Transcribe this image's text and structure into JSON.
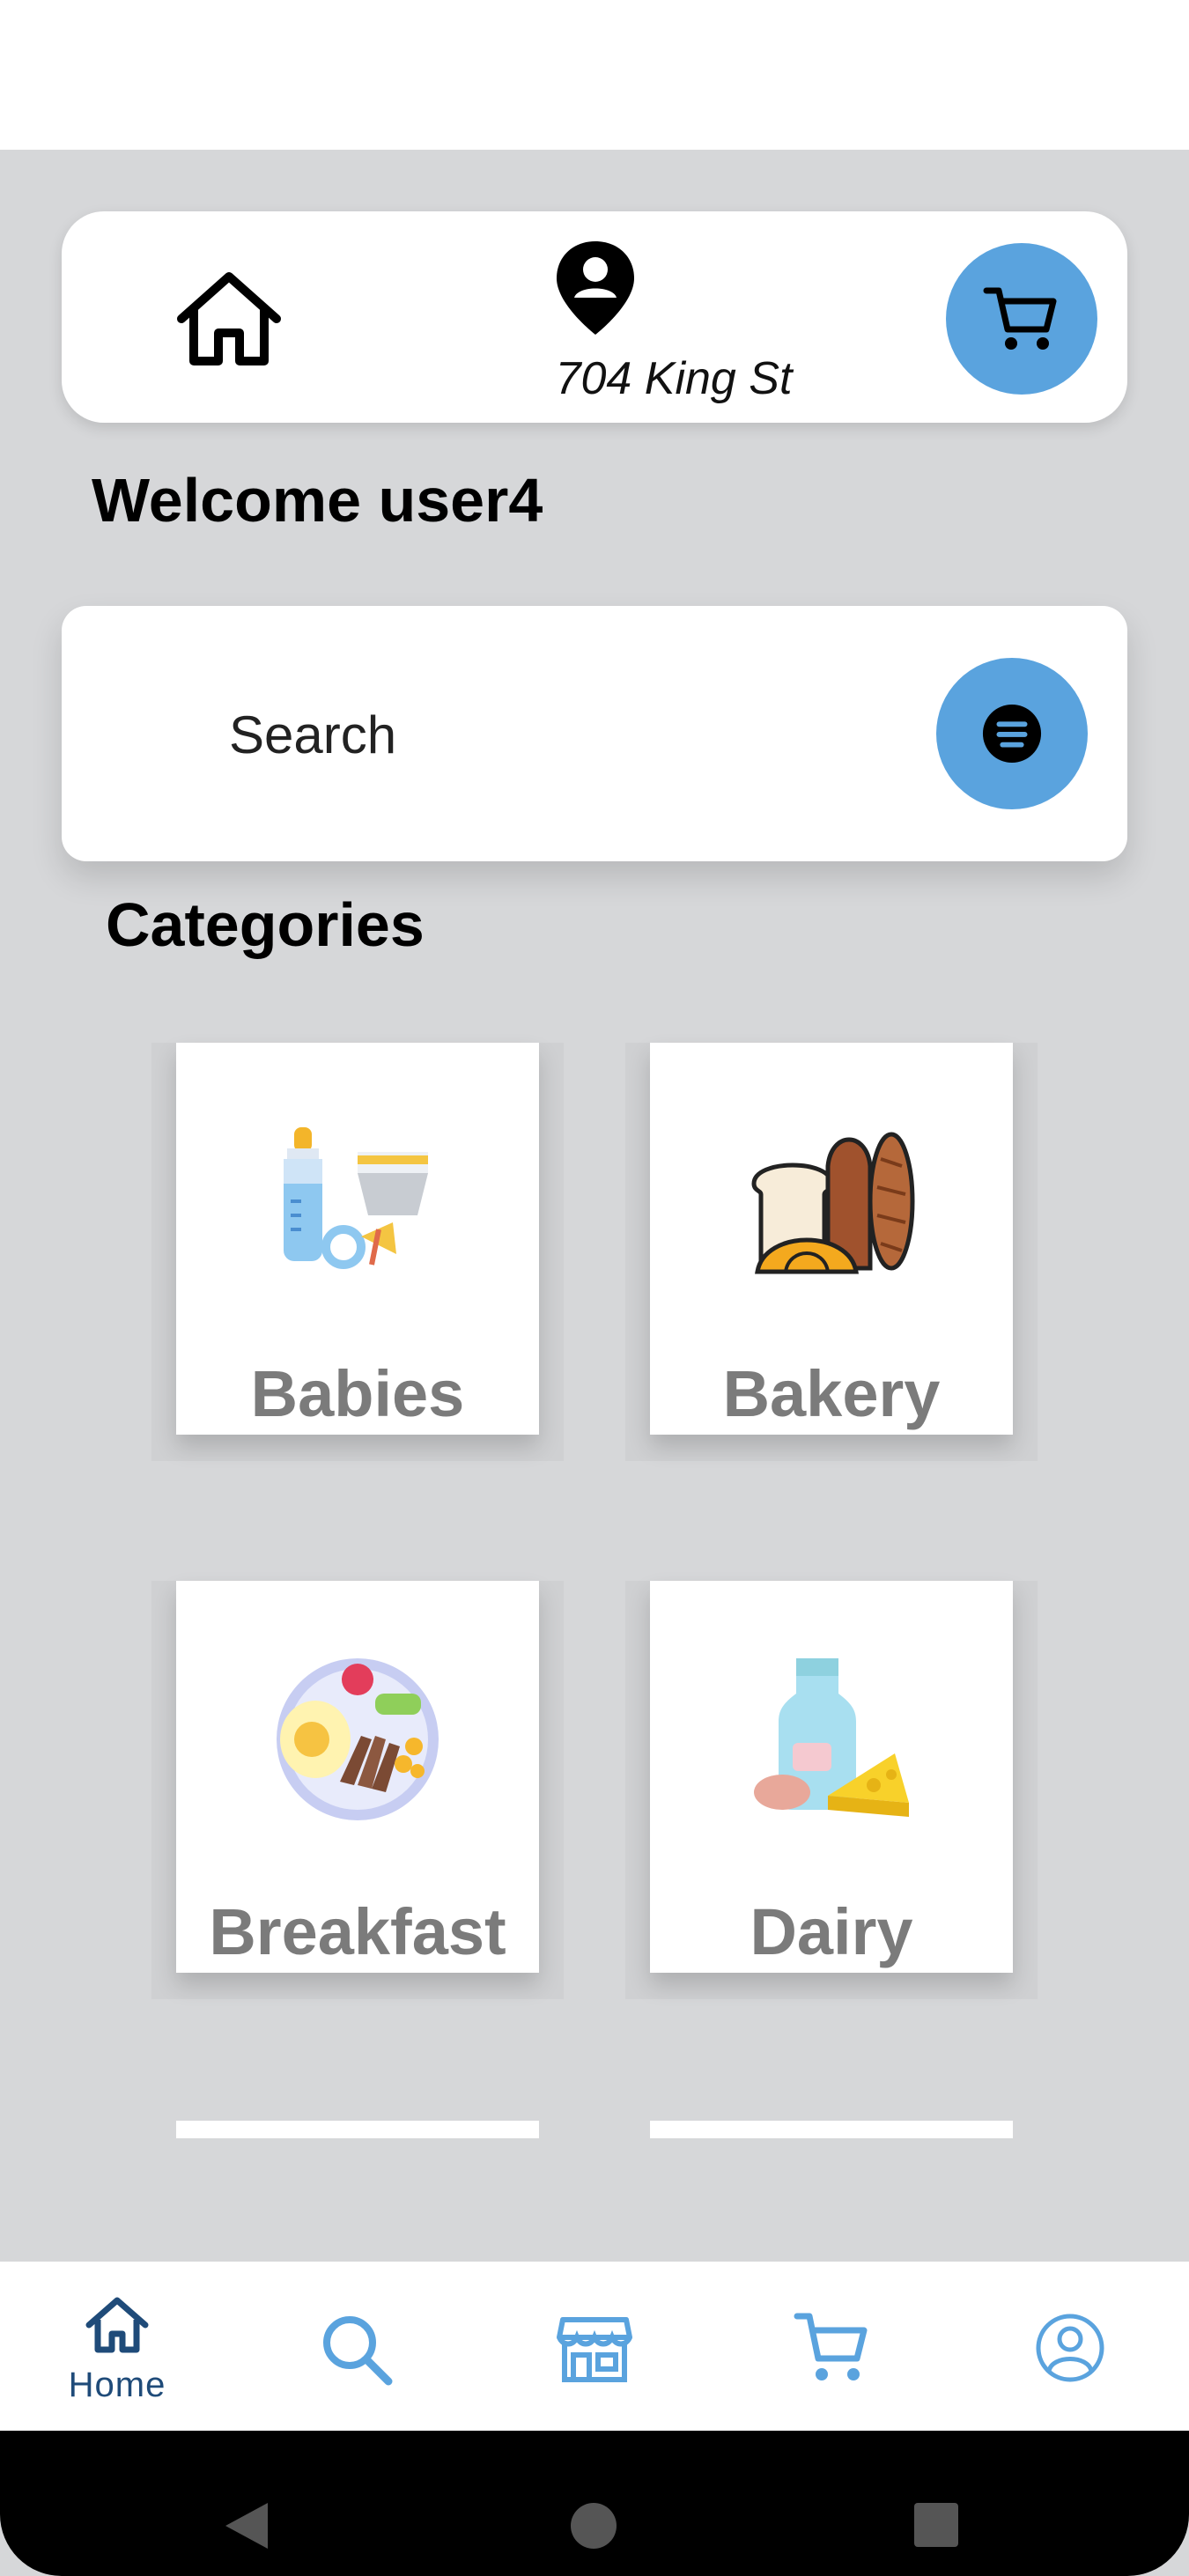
{
  "header": {
    "location": "704 King St"
  },
  "welcome_text": "Welcome user4",
  "search": {
    "placeholder": "Search"
  },
  "categories_heading": "Categories",
  "categories": [
    {
      "label": "Babies",
      "icon": "baby-bottle-icon"
    },
    {
      "label": "Bakery",
      "icon": "bread-icon"
    },
    {
      "label": "Breakfast",
      "icon": "breakfast-plate-icon"
    },
    {
      "label": "Dairy",
      "icon": "milk-cheese-icon"
    }
  ],
  "bottom_nav": {
    "home_label": "Home",
    "items": [
      "home-icon",
      "search-icon",
      "store-icon",
      "cart-icon",
      "profile-icon"
    ]
  },
  "colors": {
    "accent": "#5aa3de",
    "nav_active": "#1f4b79",
    "nav_inactive": "#5aa3de",
    "background": "#d6d7d9"
  }
}
